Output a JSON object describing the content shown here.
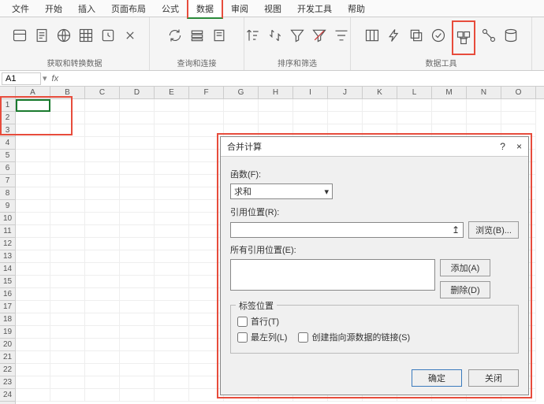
{
  "tabs": [
    "文件",
    "开始",
    "插入",
    "页面布局",
    "公式",
    "数据",
    "审阅",
    "视图",
    "开发工具",
    "帮助"
  ],
  "active_tab": "数据",
  "ribbon": {
    "group1": "获取和转换数据",
    "group2": "查询和连接",
    "group3": "排序和筛选",
    "group4": "数据工具",
    "consolidate_btn": "合并计算"
  },
  "formula_bar": {
    "name_box": "A1",
    "fx": "fx"
  },
  "columns": [
    "A",
    "B",
    "C",
    "D",
    "E",
    "F",
    "G",
    "H",
    "I",
    "J",
    "K",
    "L",
    "M",
    "N",
    "O"
  ],
  "rows": [
    "1",
    "2",
    "3",
    "4",
    "5",
    "6",
    "7",
    "8",
    "9",
    "10",
    "11",
    "12",
    "13",
    "14",
    "15",
    "16",
    "17",
    "18",
    "19",
    "20",
    "21",
    "22",
    "23",
    "24"
  ],
  "dialog": {
    "title": "合并计算",
    "help": "?",
    "close": "×",
    "function_label": "函数(F):",
    "function_value": "求和",
    "ref_label": "引用位置(R):",
    "browse_btn": "浏览(B)...",
    "all_ref_label": "所有引用位置(E):",
    "add_btn": "添加(A)",
    "delete_btn": "删除(D)",
    "labels_group": "标签位置",
    "chk_first_row": "首行(T)",
    "chk_left_col": "最左列(L)",
    "chk_link": "创建指向源数据的链接(S)",
    "ok_btn": "确定",
    "close_btn": "关闭"
  }
}
